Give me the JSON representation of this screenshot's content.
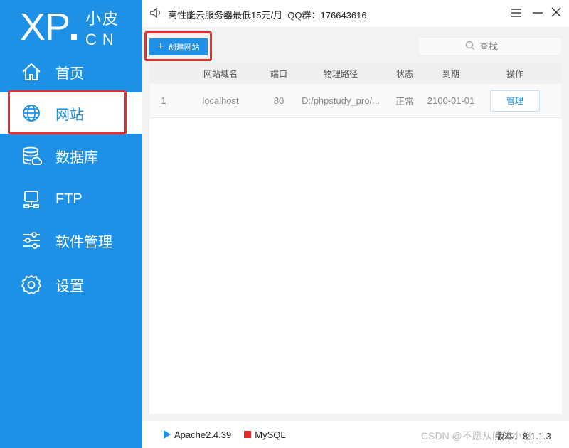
{
  "logo": {
    "brand": "XP",
    "name_cn": "小皮",
    "suffix": "CN"
  },
  "sidebar": {
    "items": [
      {
        "label": "首页",
        "icon": "home-icon"
      },
      {
        "label": "网站",
        "icon": "globe-icon",
        "active": true
      },
      {
        "label": "数据库",
        "icon": "database-icon"
      },
      {
        "label": "FTP",
        "icon": "server-icon"
      },
      {
        "label": "软件管理",
        "icon": "sliders-icon"
      },
      {
        "label": "设置",
        "icon": "gear-icon"
      }
    ]
  },
  "topbar": {
    "notice": "高性能云服务器最低15元/月  QQ群：176643616",
    "icons": [
      "speaker-icon",
      "menu-icon",
      "minimize-icon",
      "close-icon"
    ]
  },
  "toolbar": {
    "create_label": "创建网站",
    "search_placeholder": "查找"
  },
  "table": {
    "headers": [
      "",
      "网站域名",
      "端口",
      "物理路径",
      "状态",
      "到期",
      "操作"
    ],
    "rows": [
      {
        "index": "1",
        "domain": "localhost",
        "port": "80",
        "path": "D:/phpstudy_pro/...",
        "status": "正常",
        "expire": "2100-01-01",
        "action": "管理"
      }
    ]
  },
  "footer": {
    "services": [
      {
        "name": "Apache2.4.39",
        "state_color": "#1e90e6",
        "state": "running"
      },
      {
        "name": "MySQL",
        "state_color": "#e32b2b",
        "state": "stopped"
      }
    ],
    "watermark": "CSDN @不愿从问的小赵",
    "version": "版本：8.1.1.3"
  },
  "colors": {
    "accent": "#1e90e6",
    "highlight": "#e82c2c",
    "stopped": "#e32b2b"
  }
}
